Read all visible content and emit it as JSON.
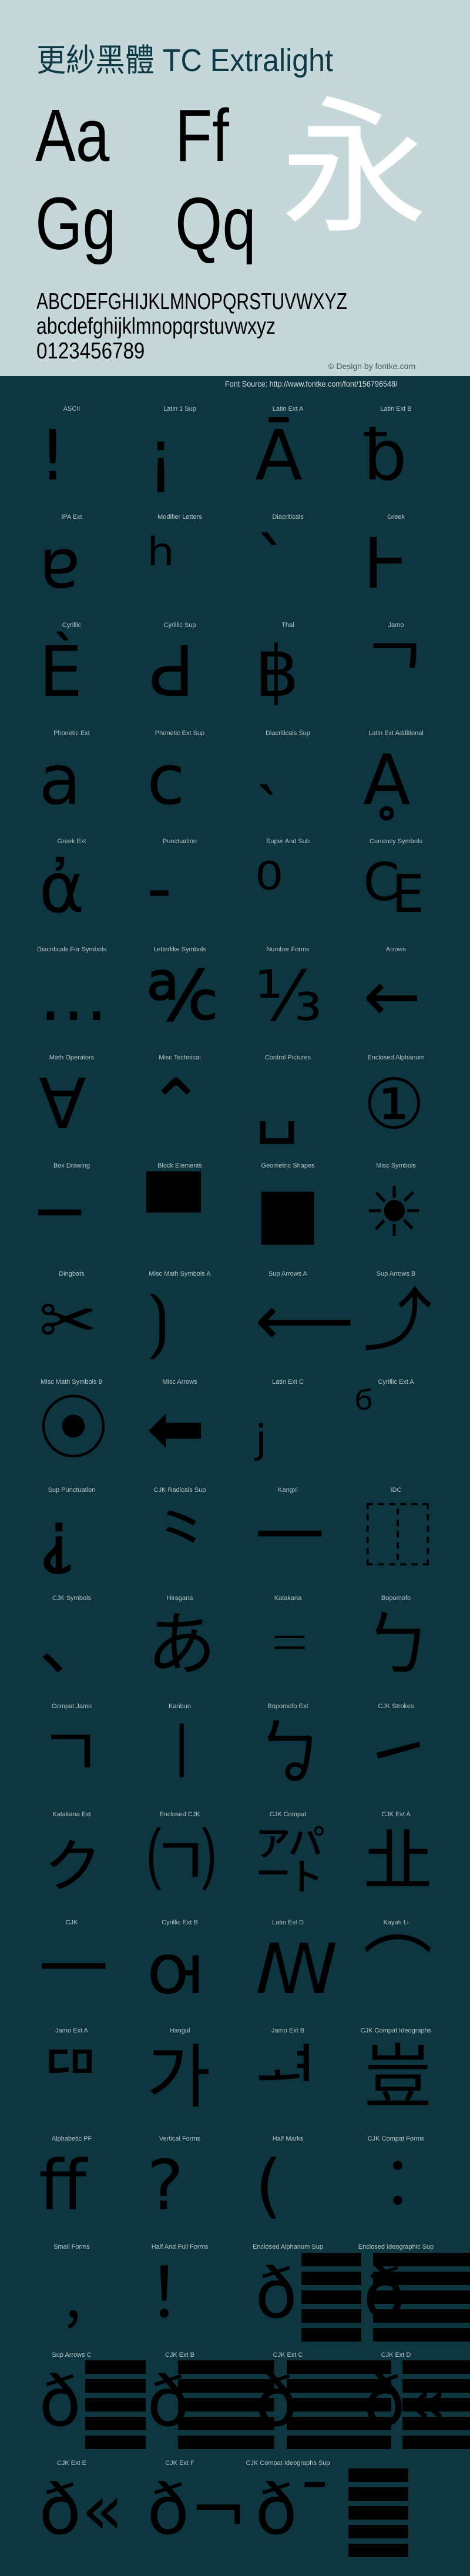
{
  "header": {
    "title": "更紗黑體 TC Extralight",
    "specimen_pairs": [
      "Aa",
      "Ff",
      "Gg",
      "Qq"
    ],
    "hero_glyph": "永",
    "uppercase": "ABCDEFGHIJKLMNOPQRSTUVWXYZ",
    "lowercase": "abcdefghijklmnopqrstuvwxyz",
    "digits": "0123456789",
    "credit": "© Design by fontke.com"
  },
  "source": "Font Source: http://www.fontke.com/font/156796548/",
  "colors": {
    "header_bg": "#c5d7d8",
    "body_bg": "#0d3641",
    "title": "#0d3a45",
    "hero_glyph": "#ffffff",
    "label": "#b3c3c7"
  },
  "blocks": [
    {
      "label": "ASCII",
      "glyph": "!"
    },
    {
      "label": "Latin 1 Sup",
      "glyph": "¡"
    },
    {
      "label": "Latin Ext A",
      "glyph": "Ā"
    },
    {
      "label": "Latin Ext B",
      "glyph": "ƀ"
    },
    {
      "label": "IPA Ext",
      "glyph": "ɐ"
    },
    {
      "label": "Modifier Letters",
      "glyph": "ʰ"
    },
    {
      "label": "Diacriticals",
      "glyph": "ˋ"
    },
    {
      "label": "Greek",
      "glyph": "Ͱ"
    },
    {
      "label": "Cyrillic",
      "glyph": "Ѐ"
    },
    {
      "label": "Cyrillic Sup",
      "glyph": "Ԁ"
    },
    {
      "label": "Thai",
      "glyph": "฿"
    },
    {
      "label": "Jamo",
      "glyph": "ᄀ"
    },
    {
      "label": "Phonetic Ext",
      "glyph": "a"
    },
    {
      "label": "Phonetic Ext Sup",
      "glyph": "c"
    },
    {
      "label": "Diacriticals Sup",
      "glyph": "˴"
    },
    {
      "label": "Latin Ext Additional",
      "glyph": "Ḁ"
    },
    {
      "label": "Greek Ext",
      "glyph": "ἀ"
    },
    {
      "label": "Punctuation",
      "glyph": "‐"
    },
    {
      "label": "Super And Sub",
      "glyph": "⁰"
    },
    {
      "label": "Currency Symbols",
      "glyph": "₠"
    },
    {
      "label": "Diacriticals For Symbols",
      "glyph": "…"
    },
    {
      "label": "Letterlike Symbols",
      "glyph": "℀"
    },
    {
      "label": "Number Forms",
      "glyph": "⅓"
    },
    {
      "label": "Arrows",
      "glyph": "←"
    },
    {
      "label": "Math Operators",
      "glyph": "∀"
    },
    {
      "label": "Misc Technical",
      "glyph": "⌃"
    },
    {
      "label": "Control Pictures",
      "glyph": "␣"
    },
    {
      "label": "Enclosed Alphanum",
      "glyph": "①"
    },
    {
      "label": "Box Drawing",
      "glyph": "─"
    },
    {
      "label": "Block Elements",
      "glyph": "▀"
    },
    {
      "label": "Geometric Shapes",
      "glyph": "■"
    },
    {
      "label": "Misc Symbols",
      "glyph": "☀"
    },
    {
      "label": "Dingbats",
      "glyph": "✂"
    },
    {
      "label": "Misc Math Symbols A",
      "glyph": "⟯"
    },
    {
      "label": "Sup Arrows A",
      "glyph": "⟵"
    },
    {
      "label": "Sup Arrows B",
      "glyph": "⤴"
    },
    {
      "label": "Misc Math Symbols B",
      "glyph": "⦿"
    },
    {
      "label": "Misc Arrows",
      "glyph": "⬅"
    },
    {
      "label": "Latin Ext C",
      "glyph": "ⱼ"
    },
    {
      "label": "Cyrillic Ext A",
      "glyph": "ⷠ"
    },
    {
      "label": "Sup Punctuation",
      "glyph": "⸘"
    },
    {
      "label": "CJK Radicals Sup",
      "glyph": "⺀"
    },
    {
      "label": "Kangxi",
      "glyph": "⼀"
    },
    {
      "label": "IDC",
      "glyph": "⿰"
    },
    {
      "label": "CJK Symbols",
      "glyph": "、"
    },
    {
      "label": "Hiragana",
      "glyph": "あ"
    },
    {
      "label": "Katakana",
      "glyph": "゠"
    },
    {
      "label": "Bopomofo",
      "glyph": "ㄅ"
    },
    {
      "label": "Compat Jamo",
      "glyph": "ㄱ"
    },
    {
      "label": "Kanbun",
      "glyph": "㆐"
    },
    {
      "label": "Bopomofo Ext",
      "glyph": "ㆠ"
    },
    {
      "label": "CJK Strokes",
      "glyph": "㇀"
    },
    {
      "label": "Katakana Ext",
      "glyph": "ㇰ"
    },
    {
      "label": "Enclosed CJK",
      "glyph": "㈀"
    },
    {
      "label": "CJK Compat",
      "glyph": "㌀"
    },
    {
      "label": "CJK Ext A",
      "glyph": "㐀"
    },
    {
      "label": "CJK",
      "glyph": "一"
    },
    {
      "label": "Cyrillic Ext B",
      "glyph": "ꙕ"
    },
    {
      "label": "Latin Ext D",
      "glyph": "ꟿ"
    },
    {
      "label": "Kayah Li",
      "glyph": "⌒"
    },
    {
      "label": "Jamo Ext A",
      "glyph": "ꥠ"
    },
    {
      "label": "Hangul",
      "glyph": "가"
    },
    {
      "label": "Jamo Ext B",
      "glyph": "ힰ"
    },
    {
      "label": "CJK Compat Ideographs",
      "glyph": "豈"
    },
    {
      "label": "Alphabetic PF",
      "glyph": "ﬀ"
    },
    {
      "label": "Vertical Forms",
      "glyph": "?"
    },
    {
      "label": "Half Marks",
      "glyph": "("
    },
    {
      "label": "CJK Compat Forms",
      "glyph": "︰"
    },
    {
      "label": "Small Forms",
      "glyph": "﹐"
    },
    {
      "label": "Half And Full Forms",
      "glyph": "！"
    },
    {
      "label": "Enclosed Alphanum Sup",
      "glyph": "ð"
    },
    {
      "label": "Enclosed Ideographic Sup",
      "glyph": "ð"
    },
    {
      "label": "Sup Arrows C",
      "glyph": "ð"
    },
    {
      "label": "CJK Ext B",
      "glyph": "ð"
    },
    {
      "label": "CJK Ext C",
      "glyph": "ð"
    },
    {
      "label": "CJK Ext D",
      "glyph": "ð«"
    },
    {
      "label": "CJK Ext E",
      "glyph": "ð«"
    },
    {
      "label": "CJK Ext F",
      "glyph": "ð¬"
    },
    {
      "label": "CJK Compat Ideographs Sup",
      "glyph": "ð¯"
    }
  ]
}
